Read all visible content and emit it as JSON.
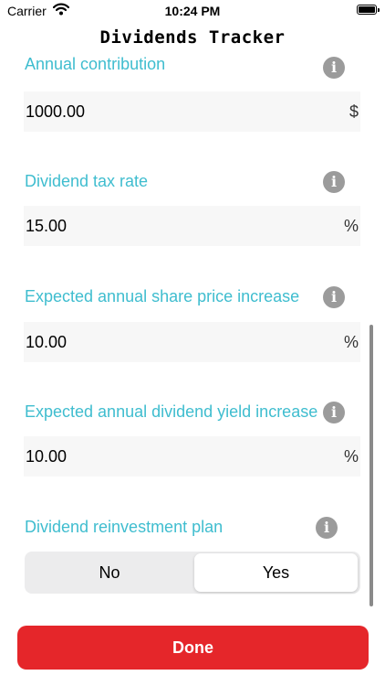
{
  "status_bar": {
    "carrier": "Carrier",
    "time": "10:24 PM"
  },
  "nav": {
    "title": "Dividends Tracker"
  },
  "fields": [
    {
      "label": "Annual contribution",
      "value": "1000.00",
      "unit": "$"
    },
    {
      "label": "Dividend tax rate",
      "value": "15.00",
      "unit": "%"
    },
    {
      "label": "Expected annual share price increase",
      "value": "10.00",
      "unit": "%"
    },
    {
      "label": "Expected annual dividend yield increase",
      "value": "10.00",
      "unit": "%"
    }
  ],
  "info_glyph": "i",
  "reinvestment": {
    "label": "Dividend reinvestment plan",
    "options": [
      "No",
      "Yes"
    ],
    "selected": "Yes"
  },
  "done_label": "Done",
  "colors": {
    "label": "#3fbdcf",
    "done": "#e5262a",
    "info": "#9b9b9b"
  },
  "icons": [
    "wifi-icon",
    "battery-icon",
    "info-icon"
  ]
}
